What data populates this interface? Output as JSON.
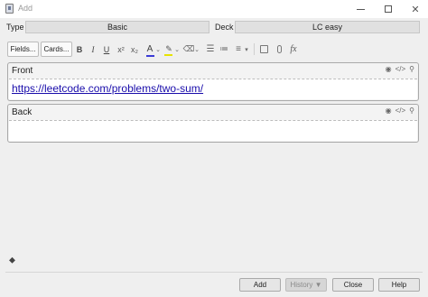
{
  "window": {
    "title": "Add"
  },
  "header": {
    "type_label": "Type",
    "type_value": "Basic",
    "deck_label": "Deck",
    "deck_value": "LC easy"
  },
  "toolbar": {
    "fields_label": "Fields...",
    "cards_label": "Cards...",
    "icons": [
      "bold-icon",
      "italic-icon",
      "underline-icon",
      "superscript-icon",
      "subscript-icon",
      "text-color-icon",
      "highlight-icon",
      "eraser-icon",
      "bullet-list-icon",
      "numbered-list-icon",
      "align-icon",
      "image-icon",
      "microphone-icon",
      "formula-icon"
    ]
  },
  "fields": [
    {
      "name": "Front",
      "value": "https://leetcode.com/problems/two-sum/"
    },
    {
      "name": "Back",
      "value": ""
    }
  ],
  "buttons": {
    "add": "Add",
    "history": "History ▼",
    "close": "Close",
    "help": "Help"
  }
}
